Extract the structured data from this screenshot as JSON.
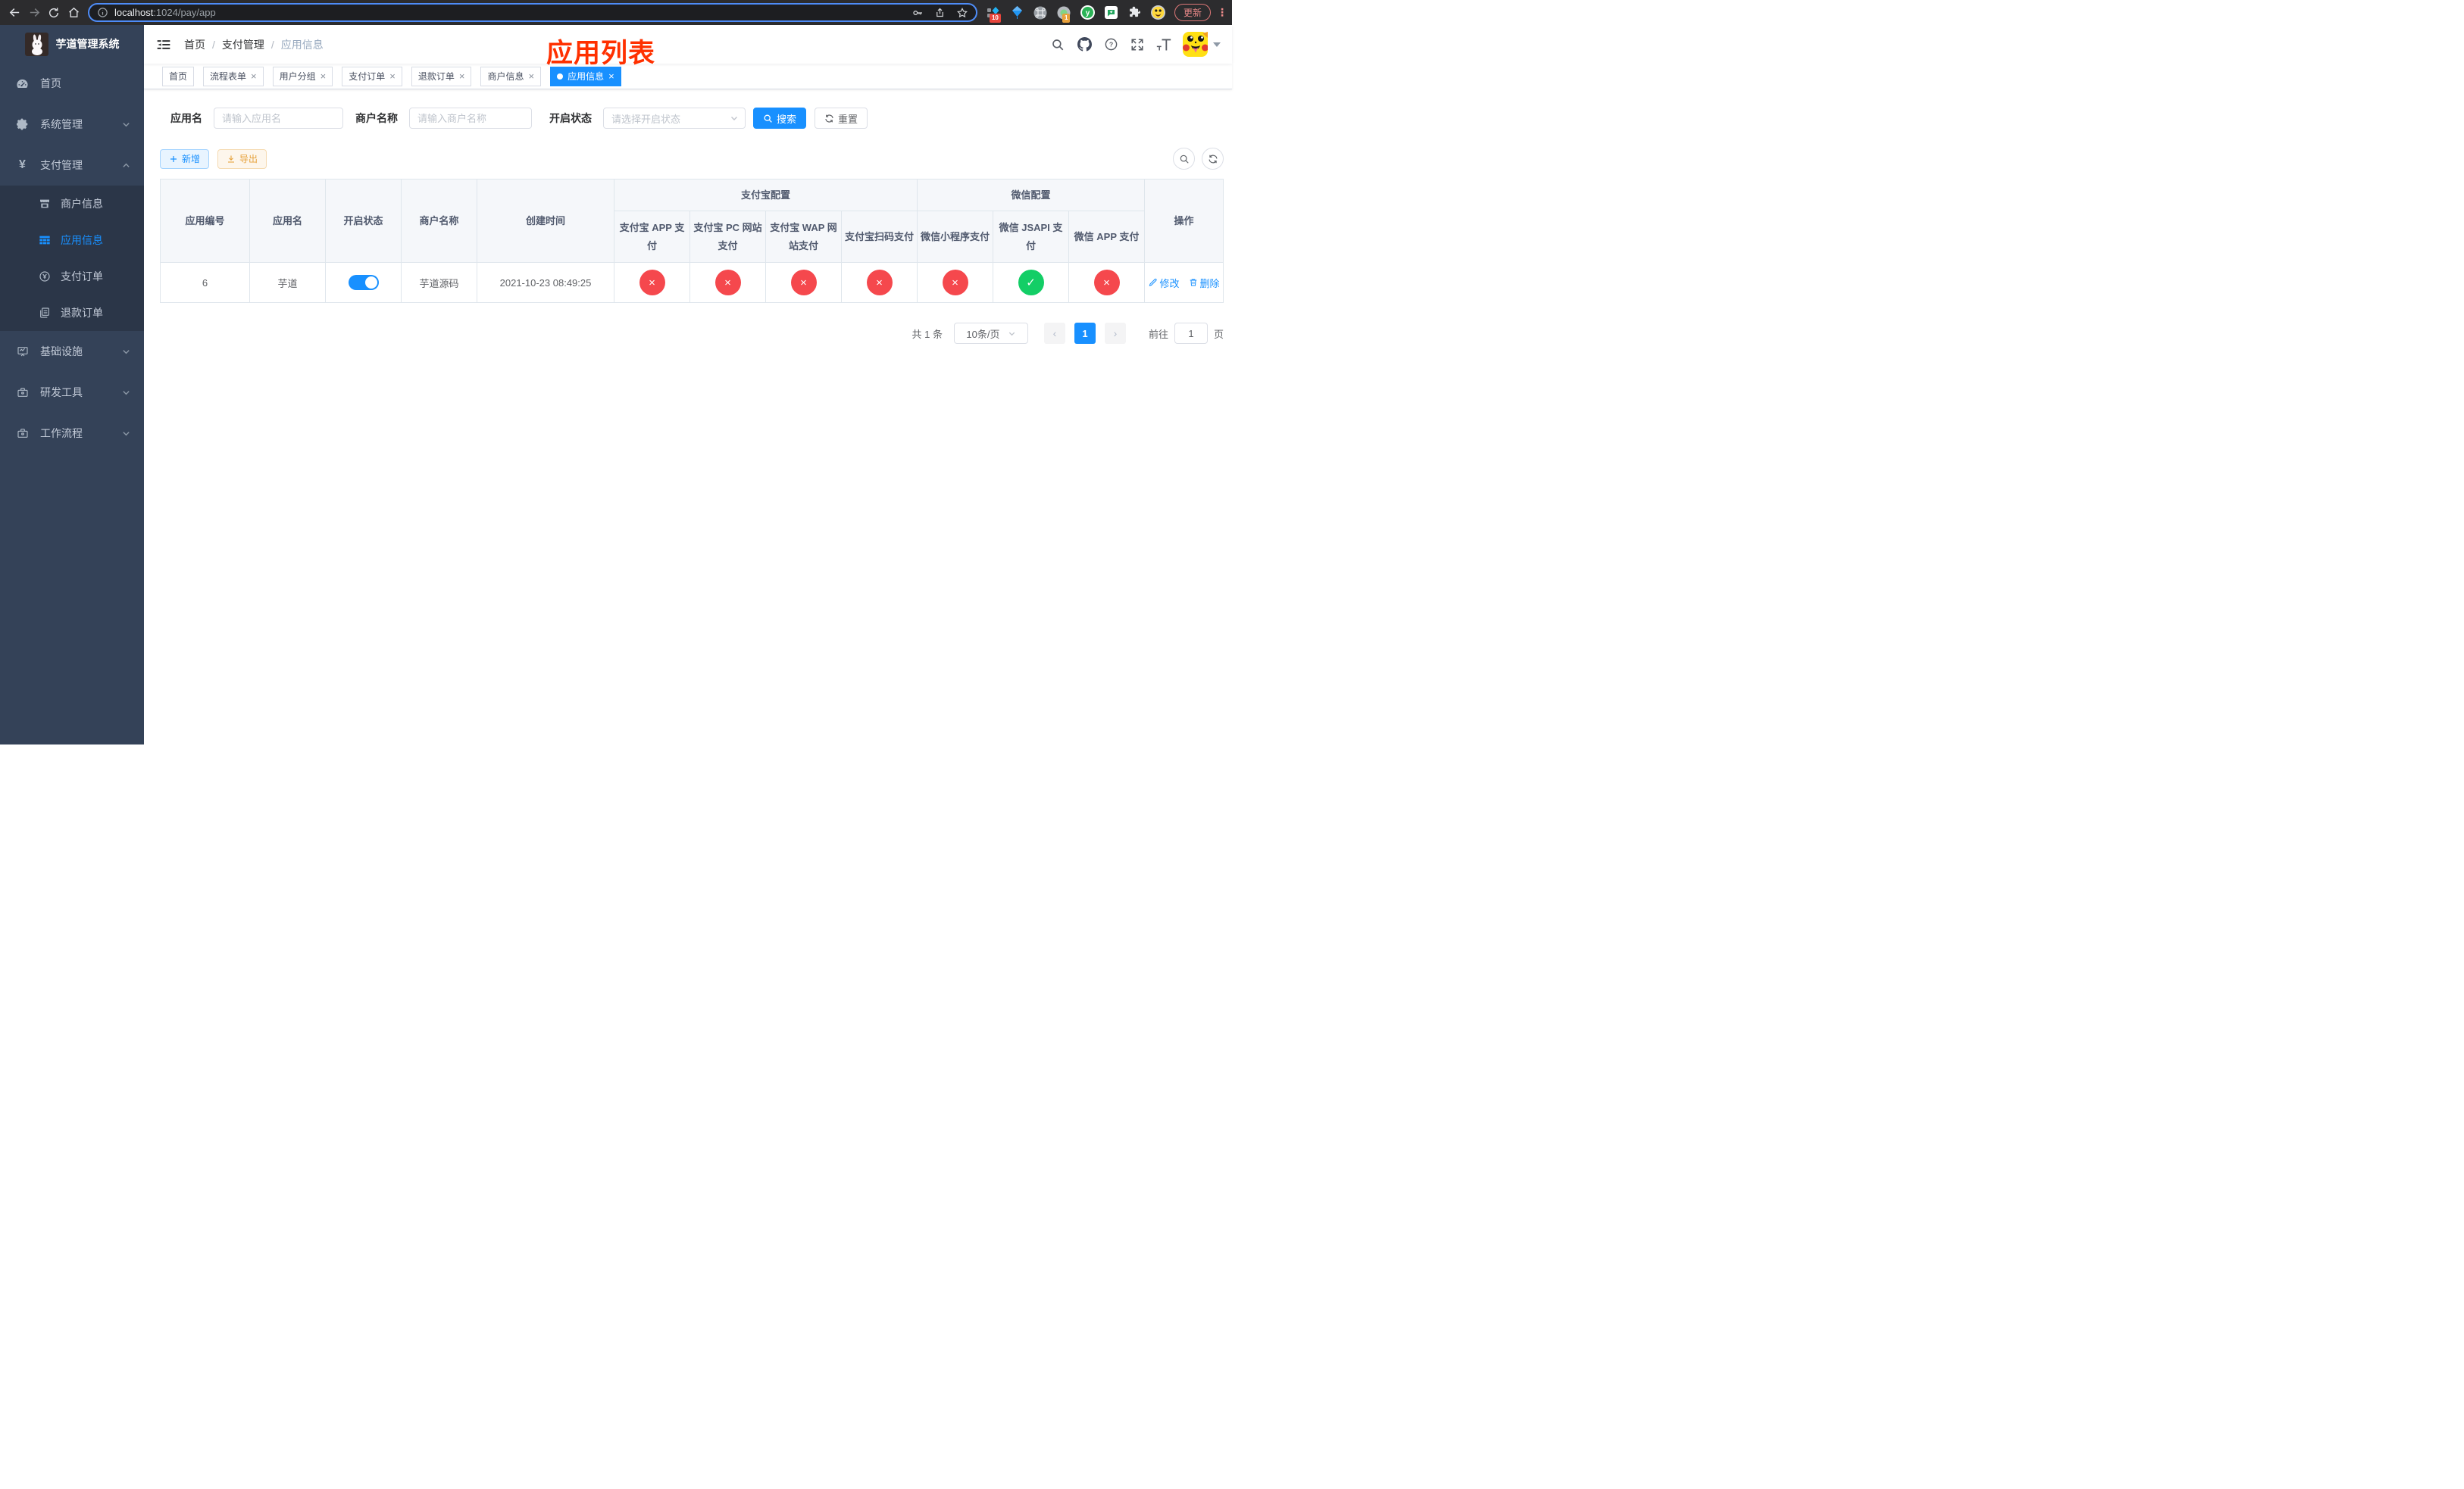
{
  "browser": {
    "url": {
      "host": "localhost",
      "path": ":1024/pay/app"
    },
    "extensions": {
      "badge_one": "10",
      "badge_two": "1",
      "y_logo": "y"
    },
    "update_button": "更新"
  },
  "icons": {
    "close": "×",
    "check": "✓",
    "cross": "×",
    "dot": "●",
    "caret": "⌄",
    "prev": "‹",
    "next": "›",
    "question": "?",
    "yen": "¥"
  },
  "sidebar": {
    "title": "芋道管理系统",
    "items": [
      {
        "label": "首页"
      },
      {
        "label": "系统管理"
      },
      {
        "label": "支付管理",
        "children": [
          {
            "label": "商户信息"
          },
          {
            "label": "应用信息"
          },
          {
            "label": "支付订单"
          },
          {
            "label": "退款订单"
          }
        ]
      },
      {
        "label": "基础设施"
      },
      {
        "label": "研发工具"
      },
      {
        "label": "工作流程"
      }
    ]
  },
  "navbar": {
    "breadcrumb": [
      "首页",
      "支付管理",
      "应用信息"
    ],
    "separator": "/",
    "annotation": "应用列表"
  },
  "tags": [
    {
      "label": "首页"
    },
    {
      "label": "流程表单"
    },
    {
      "label": "用户分组"
    },
    {
      "label": "支付订单"
    },
    {
      "label": "退款订单"
    },
    {
      "label": "商户信息"
    },
    {
      "label": "应用信息"
    }
  ],
  "filters": {
    "app_name": {
      "label": "应用名",
      "placeholder": "请输入应用名"
    },
    "merchant": {
      "label": "商户名称",
      "placeholder": "请输入商户名称"
    },
    "status": {
      "label": "开启状态",
      "placeholder": "请选择开启状态"
    },
    "search": "搜索",
    "reset": "重置"
  },
  "toolbar": {
    "add": "新增",
    "export": "导出"
  },
  "table": {
    "headers": {
      "app_id": "应用编号",
      "app_name": "应用名",
      "status": "开启状态",
      "merchant": "商户名称",
      "created": "创建时间",
      "alipay_group": "支付宝配置",
      "wechat_group": "微信配置",
      "alipay_app": "支付宝 APP 支付",
      "alipay_pc": "支付宝 PC 网站支付",
      "alipay_wap": "支付宝 WAP 网站支付",
      "alipay_qr": "支付宝扫码支付",
      "wechat_mini": "微信小程序支付",
      "wechat_jsapi": "微信 JSAPI 支付",
      "wechat_app": "微信 APP 支付",
      "ops": "操作"
    },
    "rows": [
      {
        "id": "6",
        "name": "芋道",
        "enabled": true,
        "merchant": "芋道源码",
        "created": "2021-10-23 08:49:25",
        "channels": [
          "disabled",
          "disabled",
          "disabled",
          "disabled",
          "disabled",
          "enabled",
          "disabled"
        ],
        "edit": "修改",
        "delete": "删除"
      }
    ]
  },
  "pagination": {
    "total": "共 1 条",
    "page_size": "10条/页",
    "current": "1",
    "goto_label": "前往",
    "goto_value": "1",
    "page_unit": "页"
  },
  "colors": {
    "accent": "#1890ff",
    "danger": "#f5484d",
    "success": "#13ce66",
    "warning": "#e6a23c",
    "sidebar_bg": "#344258",
    "annotation": "#ff3000"
  }
}
